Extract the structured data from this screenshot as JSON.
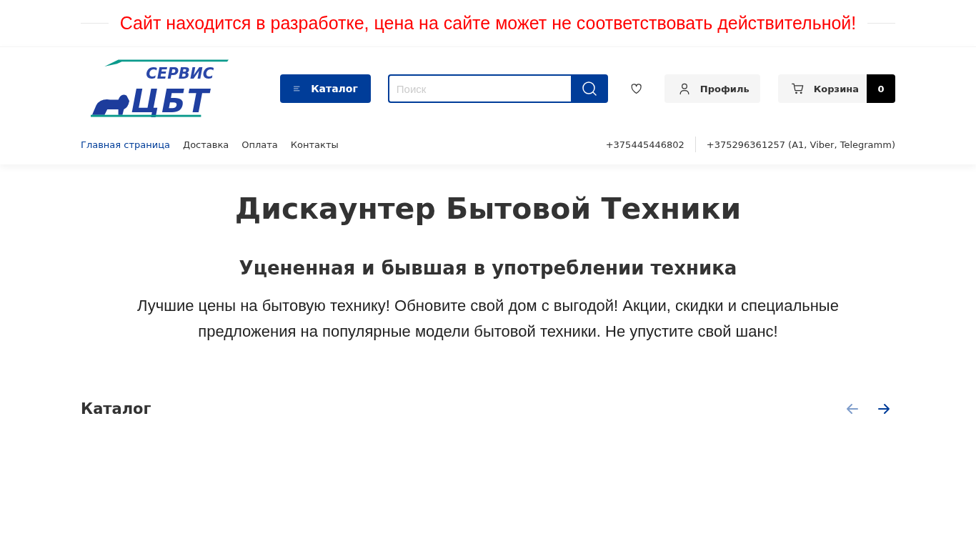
{
  "notice": "Сайт находится в разработке, цена на сайте может не соответствовать действительной!",
  "logo": {
    "top_text": "СЕРВИС",
    "main_text": "ЦБТ"
  },
  "catalog_button": "Каталог",
  "search": {
    "placeholder": "Поиск"
  },
  "profile_button": "Профиль",
  "cart": {
    "label": "Корзина",
    "count": "0"
  },
  "nav": [
    {
      "label": "Главная страница",
      "selected": true
    },
    {
      "label": "Доставка",
      "selected": false
    },
    {
      "label": "Оплата",
      "selected": false
    },
    {
      "label": "Контакты",
      "selected": false
    }
  ],
  "phones": [
    "+375445446802",
    "+375296361257 (A1, Viber, Telegramm)"
  ],
  "title": "Дискаунтер Бытовой Техники",
  "subtitle": "Уцененная и бывшая в употреблении техника",
  "intro": "Лучшие цены на бытовую технику! Обновите свой дом с выгодой! Акции, скидки и специальные предложения на популярные модели бытовой техники. Не упустите свой шанс!",
  "catalog_section": {
    "title": "Каталог",
    "arrows": [
      {
        "kind": "prev",
        "disabled": true
      },
      {
        "kind": "next",
        "disabled": false
      }
    ]
  }
}
